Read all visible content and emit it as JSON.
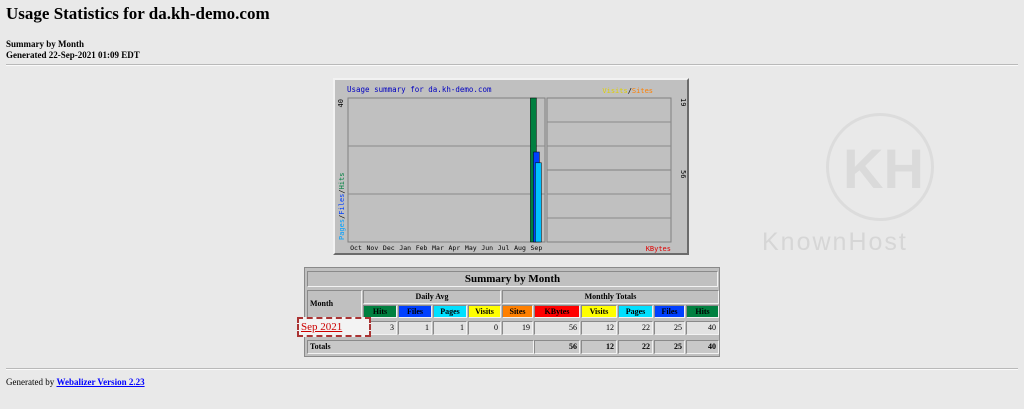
{
  "page": {
    "title": "Usage Statistics for da.kh-demo.com",
    "subtitle": "Summary by Month",
    "generated": "Generated 22-Sep-2021 01:09 EDT",
    "footer_prefix": "Generated by ",
    "footer_link": "Webalizer Version 2.23"
  },
  "graph": {
    "title": "Usage summary for da.kh-demo.com",
    "left_axis_max": "40",
    "left_axis_label": {
      "pages": "Pages",
      "files": "Files",
      "hits": "Hits",
      "sep": "/"
    },
    "right_top_max": "19",
    "right_top_label": {
      "visits": "Visits",
      "sites": "Sites",
      "sep": "/"
    },
    "right_bottom_max": "56",
    "right_bottom_label": "KBytes",
    "months": [
      "Oct",
      "Nov",
      "Dec",
      "Jan",
      "Feb",
      "Mar",
      "Apr",
      "May",
      "Jun",
      "Jul",
      "Aug",
      "Sep"
    ],
    "colors": {
      "hits": "#008040",
      "files": "#0040ff",
      "pages": "#00c0ff",
      "visits": "#ffff00",
      "sites": "#ff8000",
      "kbytes": "#ff0000"
    }
  },
  "chart_data": {
    "type": "bar",
    "categories": [
      "Oct",
      "Nov",
      "Dec",
      "Jan",
      "Feb",
      "Mar",
      "Apr",
      "May",
      "Jun",
      "Jul",
      "Aug",
      "Sep"
    ],
    "series": [
      {
        "name": "Hits",
        "values": [
          0,
          0,
          0,
          0,
          0,
          0,
          0,
          0,
          0,
          0,
          0,
          40
        ]
      },
      {
        "name": "Files",
        "values": [
          0,
          0,
          0,
          0,
          0,
          0,
          0,
          0,
          0,
          0,
          0,
          25
        ]
      },
      {
        "name": "Pages",
        "values": [
          0,
          0,
          0,
          0,
          0,
          0,
          0,
          0,
          0,
          0,
          0,
          22
        ]
      },
      {
        "name": "Sites",
        "values": [
          0,
          0,
          0,
          0,
          0,
          0,
          0,
          0,
          0,
          0,
          0,
          19
        ]
      },
      {
        "name": "Visits",
        "values": [
          0,
          0,
          0,
          0,
          0,
          0,
          0,
          0,
          0,
          0,
          0,
          12
        ]
      },
      {
        "name": "KBytes",
        "values": [
          0,
          0,
          0,
          0,
          0,
          0,
          0,
          0,
          0,
          0,
          0,
          56
        ]
      }
    ],
    "title": "Usage summary for da.kh-demo.com",
    "ylim": [
      0,
      40
    ]
  },
  "summary": {
    "title": "Summary by Month",
    "month_header": "Month",
    "daily_avg_header": "Daily Avg",
    "monthly_totals_header": "Monthly Totals",
    "daily_cols": [
      "Hits",
      "Files",
      "Pages",
      "Visits"
    ],
    "monthly_cols": [
      "Sites",
      "KBytes",
      "Visits",
      "Pages",
      "Files",
      "Hits"
    ],
    "col_colors": [
      "#008040",
      "#0040ff",
      "#00e0ff",
      "#ffff00",
      "#ff8000",
      "#ff0000",
      "#ffff00",
      "#00e0ff",
      "#0040ff",
      "#008040"
    ],
    "row": {
      "month": "Sep 2021",
      "values": [
        "3",
        "1",
        "1",
        "0",
        "19",
        "56",
        "12",
        "22",
        "25",
        "40"
      ]
    },
    "totals_label": "Totals",
    "totals": [
      "56",
      "12",
      "22",
      "25",
      "40"
    ]
  },
  "watermark": {
    "logo": "KH",
    "text": "KnownHost"
  }
}
